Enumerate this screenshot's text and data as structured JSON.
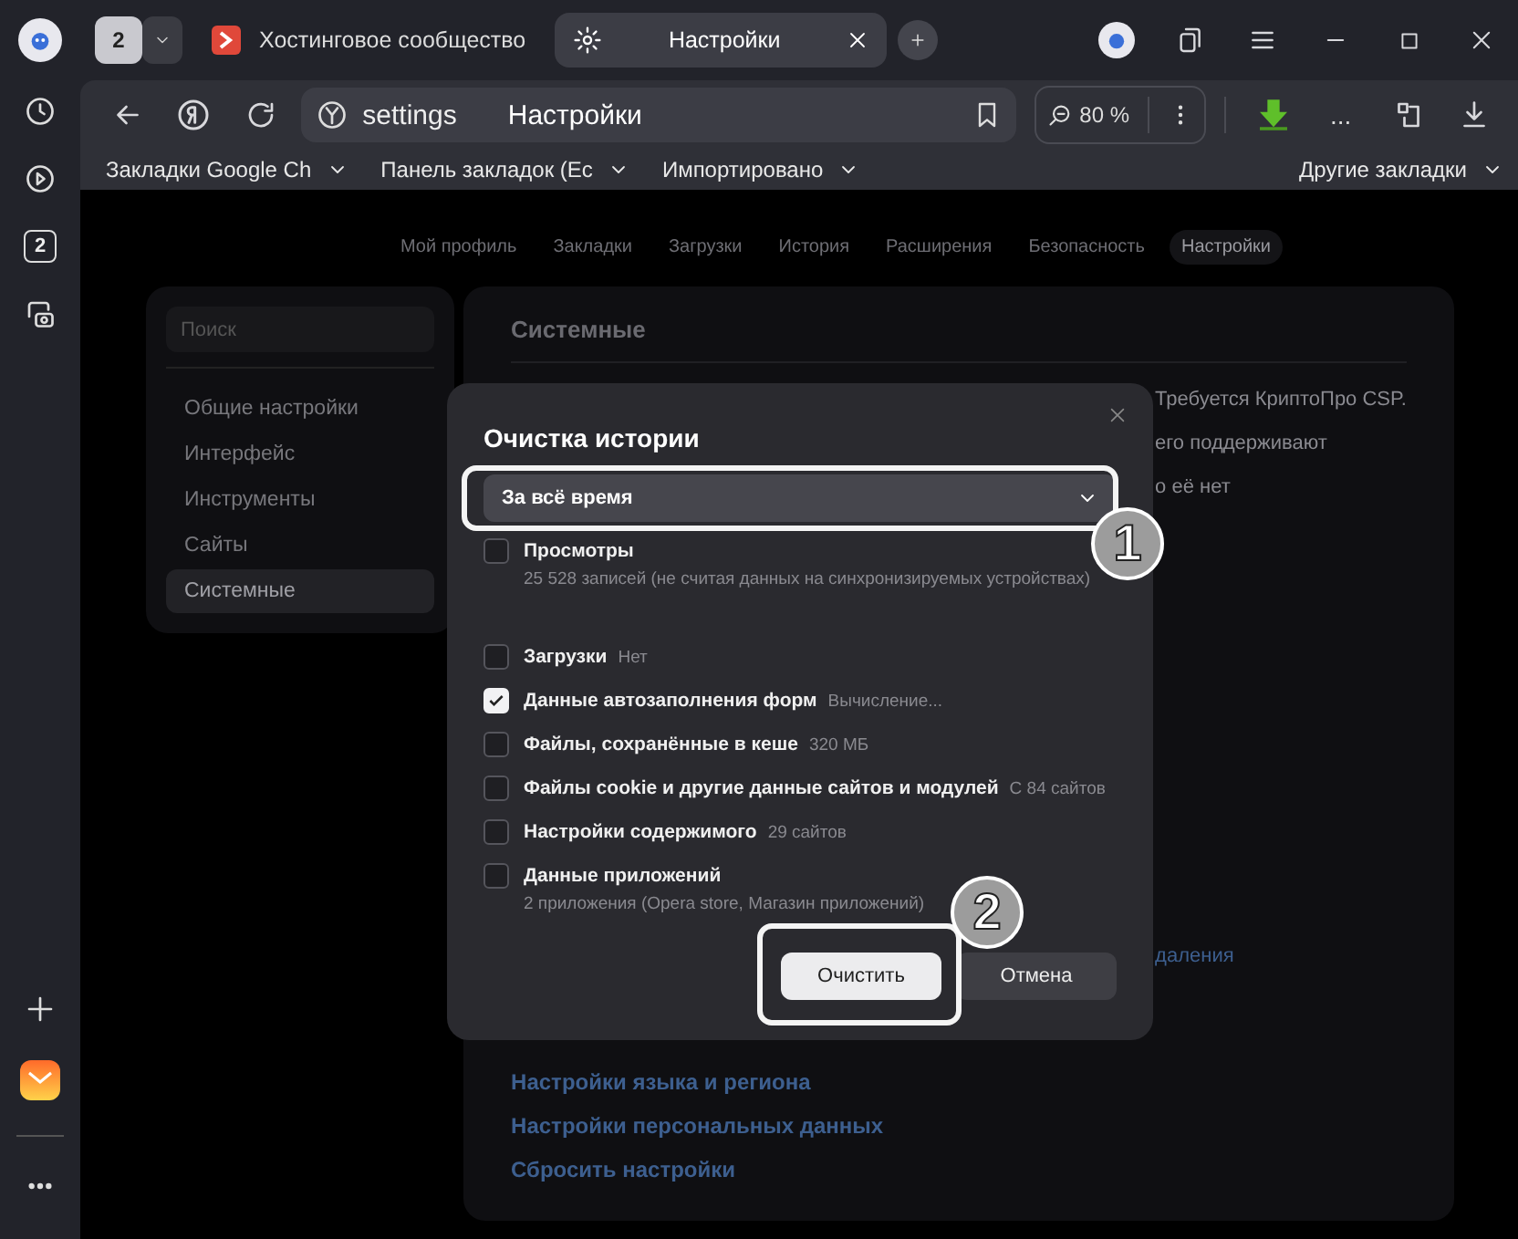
{
  "tab_strip": {
    "tab_counter": "2",
    "tabs": [
      {
        "title": "Хостинговое сообщество",
        "selected": false
      },
      {
        "title": "Настройки",
        "selected": true
      }
    ]
  },
  "toolbar": {
    "address": "settings",
    "page_title": "Настройки",
    "zoom": "80 %",
    "more": "..."
  },
  "bookmarks": [
    {
      "label": "Закладки Google Ch"
    },
    {
      "label": "Панель закладок (Ec"
    },
    {
      "label": "Импортировано"
    }
  ],
  "other_bookmarks": "Другие закладки",
  "sidebar": {
    "badge": "2"
  },
  "settings_nav": [
    {
      "label": "Мой профиль",
      "selected": false
    },
    {
      "label": "Закладки",
      "selected": false
    },
    {
      "label": "Загрузки",
      "selected": false
    },
    {
      "label": "История",
      "selected": false
    },
    {
      "label": "Расширения",
      "selected": false
    },
    {
      "label": "Безопасность",
      "selected": false
    },
    {
      "label": "Настройки",
      "selected": true
    }
  ],
  "settings_sidebar": {
    "search_placeholder": "Поиск",
    "items": [
      {
        "label": "Общие настройки",
        "selected": false
      },
      {
        "label": "Интерфейс",
        "selected": false
      },
      {
        "label": "Инструменты",
        "selected": false
      },
      {
        "label": "Сайты",
        "selected": false
      },
      {
        "label": "Системные",
        "selected": true
      }
    ]
  },
  "section": {
    "title": "Системные",
    "fragments": [
      "Требуется КриптоПро CSP.",
      "его поддерживают",
      "о её нет"
    ],
    "fragment_lower": "даления",
    "links": [
      "Настройки языка и региона",
      "Настройки персональных данных",
      "Сбросить настройки"
    ]
  },
  "dialog": {
    "title": "Очистка истории",
    "period": "За всё время",
    "items": [
      {
        "label": "Просмотры",
        "detail": "25 528 записей (не считая данных на синхронизируемых устройствах)",
        "kind": "stacked",
        "checked": false
      },
      {
        "label": "Загрузки",
        "detail": "Нет",
        "kind": "inline",
        "checked": false
      },
      {
        "label": "Данные автозаполнения форм",
        "detail": "Вычисление...",
        "kind": "inline",
        "checked": true
      },
      {
        "label": "Файлы, сохранённые в кеше",
        "detail": "320 МБ",
        "kind": "inline",
        "checked": false
      },
      {
        "label": "Файлы cookie и другие данные сайтов и модулей",
        "detail": "С 84 сайтов",
        "kind": "inline",
        "checked": false
      },
      {
        "label": "Настройки содержимого",
        "detail": "29 сайтов",
        "kind": "inline",
        "checked": false
      },
      {
        "label": "Данные приложений",
        "detail": "2 приложения (Opera store, Магазин приложений)",
        "kind": "stacked",
        "checked": false
      }
    ],
    "buttons": [
      {
        "label": "Очистить",
        "kind": "primary"
      },
      {
        "label": "Отмена",
        "kind": "secondary"
      }
    ]
  },
  "annotations": [
    {
      "number": "1"
    },
    {
      "number": "2"
    }
  ]
}
